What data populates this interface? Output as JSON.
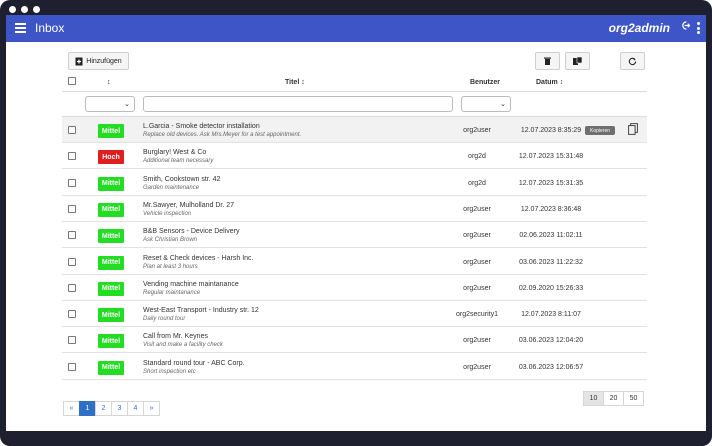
{
  "header": {
    "title": "Inbox",
    "user": "org2admin",
    "bar_color": "#3d55c6"
  },
  "toolbar": {
    "add_label": "Hinzufügen",
    "delete_icon": "trash-icon",
    "copy_icon": "copy-icon",
    "refresh_icon": "refresh-icon"
  },
  "table": {
    "columns": {
      "type_sort": "↕",
      "title": "Titel ↕",
      "user": "Benutzer",
      "date": "Datum ↕"
    },
    "rows": [
      {
        "priority": "Mittel",
        "title": "L.Garcia - Smoke detector installation",
        "subtitle": "Replace old devices. Ask Mrs.Meyer for a test appointment.",
        "user": "org2user",
        "date": "12.07.2023 8:35:29"
      },
      {
        "priority": "Hoch",
        "title": "Burglary! West & Co",
        "subtitle": "Additional team necessary",
        "user": "org2d",
        "date": "12.07.2023 15:31:48"
      },
      {
        "priority": "Mittel",
        "title": "Smith, Cookstown str. 42",
        "subtitle": "Garden maintenance",
        "user": "org2d",
        "date": "12.07.2023 15:31:35"
      },
      {
        "priority": "Mittel",
        "title": "Mr.Sawyer, Mulholland Dr. 27",
        "subtitle": "Vehicle inspection",
        "user": "org2user",
        "date": "12.07.2023 8:36:48"
      },
      {
        "priority": "Mittel",
        "title": "B&B Sensors - Device Delivery",
        "subtitle": "Ask Christian Brown",
        "user": "org2user",
        "date": "02.06.2023 11:02:11"
      },
      {
        "priority": "Mittel",
        "title": "Reset & Check devices - Harsh Inc.",
        "subtitle": "Plan at least 3 hours",
        "user": "org2user",
        "date": "03.06.2023 11:22:32"
      },
      {
        "priority": "Mittel",
        "title": "Vending machine maintanance",
        "subtitle": "Regular maintanance",
        "user": "org2user",
        "date": "02.09.2020 15:26:33"
      },
      {
        "priority": "Mittel",
        "title": "West-East Transport - Industry str. 12",
        "subtitle": "Daily round tour",
        "user": "org2security1",
        "date": "12.07.2023 8:11:07"
      },
      {
        "priority": "Mittel",
        "title": "Call from Mr. Keynes",
        "subtitle": "Visit and make a facility check",
        "user": "org2user",
        "date": "03.06.2023 12:04:20"
      },
      {
        "priority": "Mittel",
        "title": "Standard round tour - ABC Corp.",
        "subtitle": "Short inspection etc",
        "user": "org2user",
        "date": "03.06.2023 12:06:57"
      }
    ],
    "hover_row_action": "Kopieren",
    "priority_colors": {
      "Mittel": "#22dd22",
      "Hoch": "#e01e1e"
    }
  },
  "pagination": {
    "prev": "«",
    "pages": [
      "1",
      "2",
      "3",
      "4"
    ],
    "next": "»",
    "active_page": "1"
  },
  "page_sizes": {
    "options": [
      "10",
      "20",
      "50"
    ],
    "selected": "10"
  }
}
